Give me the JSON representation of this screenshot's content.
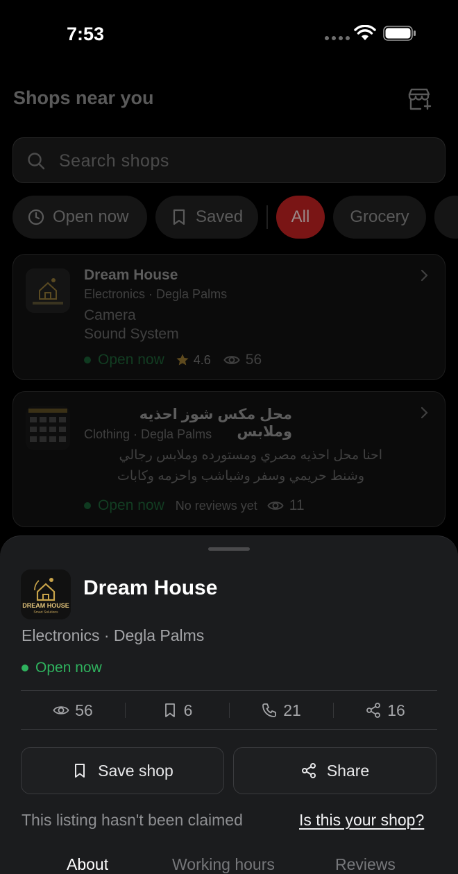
{
  "status_bar": {
    "time": "7:53"
  },
  "header": {
    "title": "Shops near you",
    "add_icon": "store-add-icon"
  },
  "search": {
    "placeholder": "Search shops"
  },
  "filters": {
    "open_now": "Open now",
    "saved": "Saved",
    "categories": [
      "All",
      "Grocery"
    ],
    "selected": "All"
  },
  "shops": [
    {
      "name": "Dream House",
      "meta": "Electronics · Degla Palms",
      "description": [
        "Camera",
        "Sound System"
      ],
      "status": "Open now",
      "rating": "4.6",
      "views": "56"
    },
    {
      "name": "محل مكس شوز احذيه وملابس",
      "meta": "Clothing · Degla Palms",
      "description": [
        "احنا محل احذيه مصري ومستورده وملابس رجالي",
        "وشنط حريمي وسفر وشباشب واحزمه وكابات"
      ],
      "status": "Open now",
      "reviews": "No reviews yet",
      "views": "11"
    }
  ],
  "sheet": {
    "logo_text": "DREAM HOUSE",
    "logo_subtext": "Smart Solutions",
    "name": "Dream House",
    "meta": "Electronics · Degla Palms",
    "status": "Open now",
    "stats": {
      "views": "56",
      "saves": "6",
      "calls": "21",
      "shares": "16"
    },
    "save_label": "Save shop",
    "share_label": "Share",
    "claim_text": "This listing hasn't been claimed",
    "claim_link": "Is this your shop?",
    "tabs": [
      "About",
      "Working hours",
      "Reviews"
    ],
    "active_tab": "About"
  },
  "colors": {
    "accent_red": "#7a1515",
    "open_green": "#2fb25e",
    "sheet_bg": "#1b1c1e"
  }
}
